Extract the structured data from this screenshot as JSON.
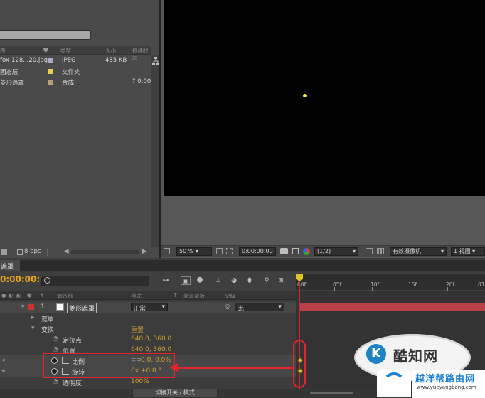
{
  "project": {
    "columns": [
      "序",
      "类型",
      "大小",
      "持续时间"
    ],
    "items": [
      {
        "name": "fox-128...20.jpg",
        "type": "JPEG",
        "size": "485 KB",
        "duration": "",
        "color": "#a9a9c9"
      },
      {
        "name": "固态层",
        "type": "文件夹",
        "size": "",
        "duration": "",
        "color": "#e6d24a"
      },
      {
        "name": "菱形遮罩",
        "type": "合成",
        "size": "",
        "duration": "? 0:00",
        "color": "#b6a07a"
      }
    ],
    "footer_bpc": "8 bpc"
  },
  "viewer": {
    "zoom": "50 %",
    "timecode": "0:00:00:00",
    "resolution": "(1/2)",
    "camera": "有效摄像机",
    "views": "1 视图"
  },
  "timeline": {
    "tab_label": "遮罩",
    "timecode": "0:00:00:00",
    "column_headers": {
      "source": "源名称",
      "mode": "模式",
      "t": "T",
      "trkmat": "轨道蒙板",
      "parent": "父级"
    },
    "ruler_ticks": [
      "00f",
      "05f",
      "10f",
      "15f",
      "20f",
      "01"
    ],
    "layer": {
      "index": "1",
      "name": "菱形遮罩",
      "mode": "正常",
      "parent": "无"
    },
    "rows": {
      "masks": "遮罩",
      "transform": "变换",
      "reset": "重置",
      "anchor": {
        "label": "定位点",
        "value": "640.0, 360.0"
      },
      "position": {
        "label": "位置",
        "value": "640.0, 360.0"
      },
      "scale": {
        "label": "比例",
        "value": "0.0, 0.0%"
      },
      "rotation": {
        "label": "旋转",
        "value": "0x +0.0 °"
      },
      "opacity": {
        "label": "透明度",
        "value": "100%"
      }
    },
    "footer": "切换开关 / 模式"
  },
  "watermark": {
    "brand1": "酷知网",
    "brand1_icon": "K",
    "brand2": "越洋帮路由网",
    "brand2_url": "www.yueyangbang.com"
  },
  "colors": {
    "timecode": "#e8a417",
    "layer_bar": "#b84048",
    "annotation": "#e3262b",
    "keyframe": "#e0b43f"
  }
}
